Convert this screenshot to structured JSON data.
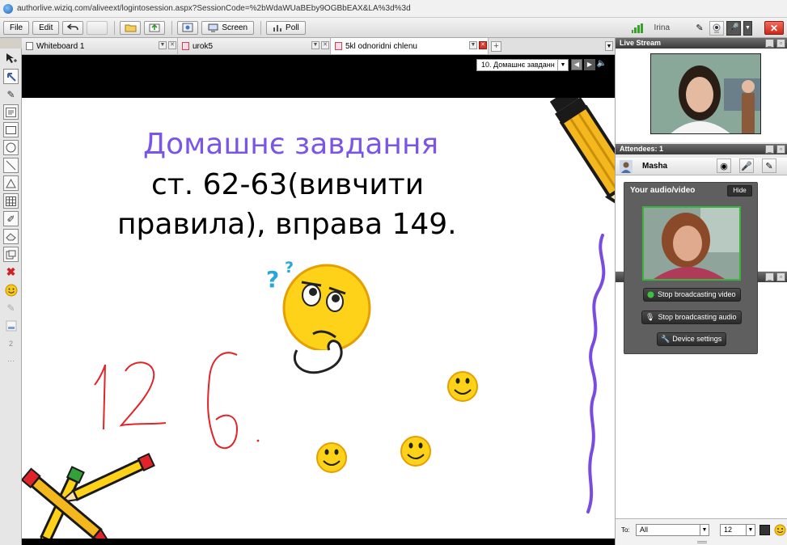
{
  "browser": {
    "url": "authorlive.wiziq.com/aliveext/logintosession.aspx?SessionCode=%2bWdaWUaBEby9OGBbEAX&LA%3d%3d"
  },
  "toolbar": {
    "file": "File",
    "edit": "Edit",
    "screen": "Screen",
    "poll": "Poll",
    "user_name": "Irina",
    "close": "✕"
  },
  "tabs": [
    {
      "label": "Whiteboard 1"
    },
    {
      "label": "urok5"
    },
    {
      "label": "5kl odnoridni chlenu"
    }
  ],
  "slide_nav": {
    "selected": "10. Домашнє завданн"
  },
  "board": {
    "title": "Домашнє завдання",
    "line1": "ст. 62-63(вивчити",
    "line2": "правила), вправа 149.",
    "handwriting": "12 б."
  },
  "panels": {
    "live_stream": "Live Stream",
    "attendees": "Attendees: 1",
    "attendee_name": "Masha",
    "your_av": "Your audio/video",
    "hide": "Hide",
    "stop_video": "Stop broadcasting video",
    "stop_audio": "Stop broadcasting audio",
    "device_settings": "Device settings"
  },
  "chat": {
    "to_label": "To:",
    "to_value": "All",
    "font_size": "12"
  },
  "colors": {
    "title_purple": "#7a55e6",
    "accent_red": "#d8362a",
    "pen_red": "#e0242a"
  }
}
